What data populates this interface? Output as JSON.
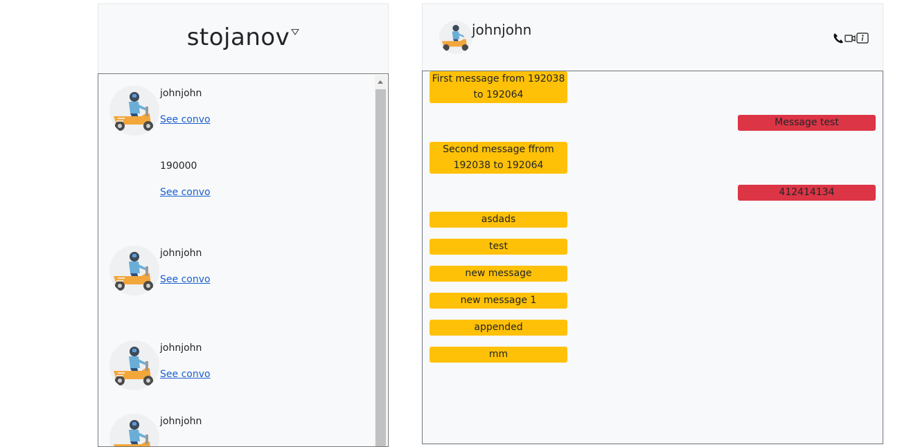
{
  "sidebar": {
    "username": "stojanov",
    "conversations": [
      {
        "name": "johnjohn",
        "link": "See convo",
        "has_avatar": true
      },
      {
        "name": "190000",
        "link": "See convo",
        "has_avatar": false
      },
      {
        "name": "johnjohn",
        "link": "See convo",
        "has_avatar": true
      },
      {
        "name": "johnjohn",
        "link": "See convo",
        "has_avatar": true
      },
      {
        "name": "johnjohn",
        "link": "",
        "has_avatar": true
      }
    ]
  },
  "chat": {
    "contact_name": "johnjohn",
    "icons": [
      "phone-icon",
      "video-icon",
      "info-icon"
    ],
    "messages": [
      {
        "text": "First message from 192038 to 192064",
        "direction": "in"
      },
      {
        "text": "Message test",
        "direction": "out"
      },
      {
        "text": "Second message ffrom 192038 to 192064",
        "direction": "in"
      },
      {
        "text": "412414134",
        "direction": "out"
      },
      {
        "text": "asdads",
        "direction": "in"
      },
      {
        "text": "test",
        "direction": "in"
      },
      {
        "text": "new message",
        "direction": "in"
      },
      {
        "text": "new message 1",
        "direction": "in"
      },
      {
        "text": "appended",
        "direction": "in"
      },
      {
        "text": "mm",
        "direction": "in"
      }
    ]
  },
  "colors": {
    "incoming": "#ffc107",
    "outgoing": "#dc3545",
    "link": "#1a5fcc",
    "panel": "#f8f9fa"
  }
}
